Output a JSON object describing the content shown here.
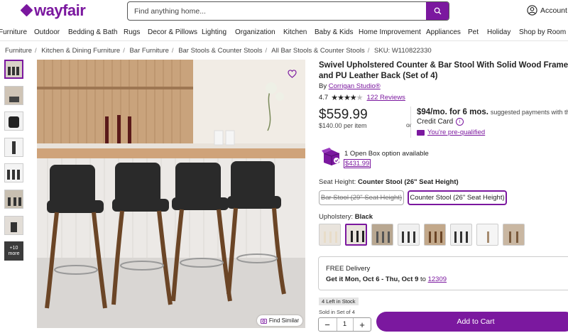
{
  "brand": {
    "logo_text": "wayfair",
    "color": "#7b189f"
  },
  "search": {
    "placeholder": "Find anything home..."
  },
  "account": {
    "label": "Account"
  },
  "nav": {
    "items": [
      "Furniture",
      "Outdoor",
      "Bedding & Bath",
      "Rugs",
      "Decor & Pillows",
      "Lighting",
      "Organization",
      "Kitchen",
      "Baby & Kids",
      "Home Improvement",
      "Appliances",
      "Pet",
      "Holiday",
      "Shop by Room"
    ]
  },
  "breadcrumb": {
    "items": [
      "Furniture",
      "Kitchen & Dining Furniture",
      "Bar Furniture",
      "Bar Stools & Counter Stools",
      "All Bar Stools & Counter Stools"
    ],
    "sku": "SKU: W110822330"
  },
  "gallery": {
    "more_label": "+10 more",
    "find_similar": "Find Similar"
  },
  "product": {
    "title": "Swivel Upholstered Counter & Bar Stool With Solid Wood Frame and PU Leather Back (Set of 4)",
    "by_prefix": "By",
    "brand": "Corrigan Studio®",
    "rating": "4.7",
    "reviews": "122 Reviews",
    "price": "$559.99",
    "per_item": "$140.00 per item",
    "or": "or",
    "monthly": "$94/mo. for 6 mos.",
    "monthly_sub": "suggested payments with th",
    "credit_card": "Credit Card",
    "prequalified": "You're pre-qualified",
    "open_box_text": "1 Open Box option available",
    "open_box_price": "$431.99"
  },
  "options": {
    "seat_height_label": "Seat Height:",
    "seat_height_value": "Counter Stool (26\" Seat Height)",
    "heights": [
      "Bar Stool (29\" Seat Height)",
      "Counter Stool (26\" Seat Height)"
    ],
    "upholstery_label": "Upholstery:",
    "upholstery_value": "Black"
  },
  "delivery": {
    "free": "FREE Delivery",
    "get_it": "Get it Mon, Oct 6 - Thu, Oct 9",
    "to": "to",
    "zip": "12309"
  },
  "purchase": {
    "stock": "4 Left in Stock",
    "sold_in": "Sold in Set of 4",
    "quantity": "1",
    "minus": "−",
    "plus": "+",
    "add_to_cart": "Add to Cart"
  }
}
